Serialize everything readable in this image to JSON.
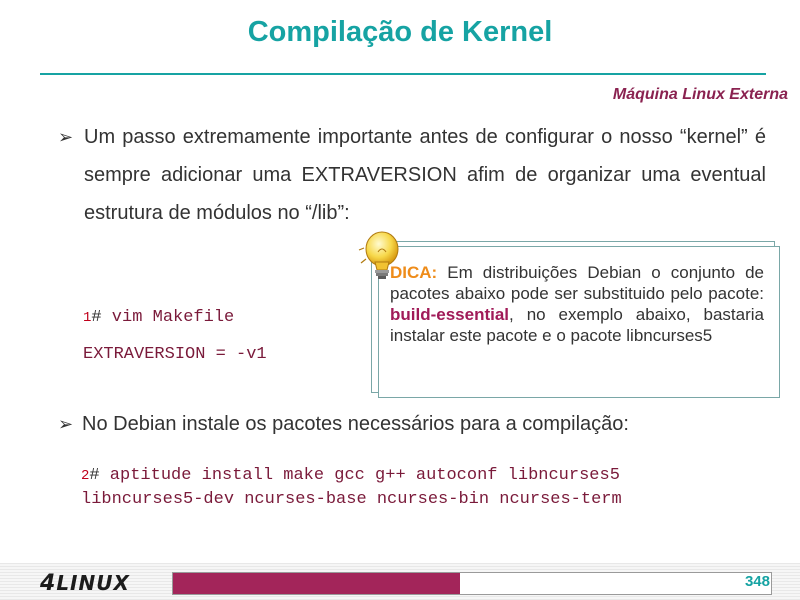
{
  "slide": {
    "title": "Compilação de Kernel",
    "subtitle": "Máquina Linux Externa",
    "bullet1": "Um passo extremamente importante antes de configurar o nosso “kernel” é sempre adicionar uma EXTRAVERSION afim de organizar uma eventual estrutura de módulos no “/lib”:",
    "cmd1_num": "1",
    "cmd1_hash": "#",
    "cmd1_text": " vim Makefile",
    "cmd1_line2": "EXTRAVERSION = -v1",
    "tip": {
      "label": "DICA:",
      "text_before": " Em distribuições Debian o conjunto de pacotes abaixo pode ser substituido pelo pacote: ",
      "package": "build-essential",
      "text_after": ", no exemplo abaixo, bastaria instalar este pacote e o pacote libncurses5",
      "icon": "lightbulb-icon"
    },
    "bullet2": "No Debian instale os pacotes necessários para a compilação:",
    "cmd2_num": "2",
    "cmd2_hash": "#",
    "cmd2_text": " aptitude install make gcc g++ autoconf libncurses5",
    "cmd2_line2": "libncurses5-dev ncurses-base ncurses-bin ncurses-term"
  },
  "footer": {
    "logo_four": "4",
    "logo_text": "LINUX",
    "page_number": "348",
    "progress": 0.48
  },
  "colors": {
    "title": "#16a3a3",
    "subtitle": "#8a2250",
    "code": "#7a1a3a",
    "tip_label": "#ee8c1a",
    "progress_fill": "#a3255a"
  }
}
